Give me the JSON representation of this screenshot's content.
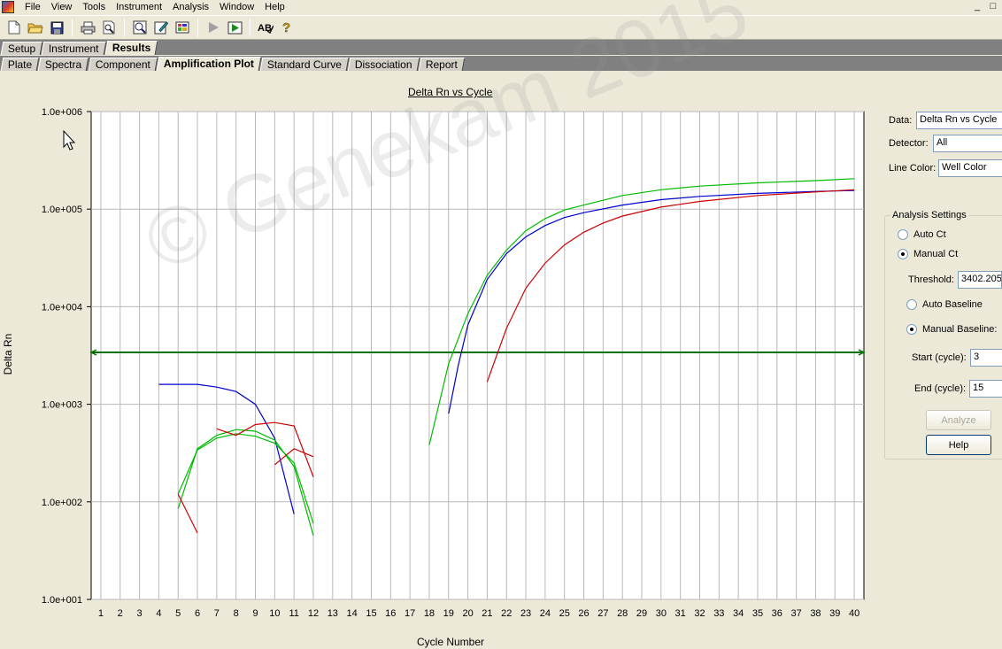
{
  "menu": [
    "File",
    "View",
    "Tools",
    "Instrument",
    "Analysis",
    "Window",
    "Help"
  ],
  "window_controls": [
    "_",
    "□"
  ],
  "toolbar_icons": [
    "new-file-icon",
    "open-folder-icon",
    "save-icon",
    "print-icon",
    "print-preview-icon",
    "zoom-icon",
    "edit-icon",
    "plate-grid-icon",
    "run-icon",
    "run-detector-icon",
    "spellcheck-icon",
    "help-icon"
  ],
  "tabs_top": [
    {
      "label": "Setup",
      "active": false
    },
    {
      "label": "Instrument",
      "active": false
    },
    {
      "label": "Results",
      "active": true
    }
  ],
  "tabs_sub": [
    {
      "label": "Plate",
      "active": false
    },
    {
      "label": "Spectra",
      "active": false
    },
    {
      "label": "Component",
      "active": false
    },
    {
      "label": "Amplification Plot",
      "active": true
    },
    {
      "label": "Standard Curve",
      "active": false
    },
    {
      "label": "Dissociation",
      "active": false
    },
    {
      "label": "Report",
      "active": false
    }
  ],
  "watermark": "© Genekam 2015",
  "chart_data": {
    "type": "line",
    "title": "Delta Rn vs Cycle",
    "xlabel": "Cycle Number",
    "ylabel": "Delta Rn",
    "yscale": "log",
    "xlim": [
      0.5,
      40.5
    ],
    "ylim": [
      10,
      1000000
    ],
    "x_ticks": [
      1,
      2,
      3,
      4,
      5,
      6,
      7,
      8,
      9,
      10,
      11,
      12,
      13,
      14,
      15,
      16,
      17,
      18,
      19,
      20,
      21,
      22,
      23,
      24,
      25,
      26,
      27,
      28,
      29,
      30,
      31,
      32,
      33,
      34,
      35,
      36,
      37,
      38,
      39,
      40
    ],
    "y_ticks": [
      10,
      100,
      1000,
      10000,
      100000,
      1000000
    ],
    "y_tick_labels": [
      "1.0e+001",
      "1.0e+002",
      "1.0e+003",
      "1.0e+004",
      "1.0e+005",
      "1.0e+006"
    ],
    "grid": true,
    "threshold": 3402.205,
    "threshold_color": "#007000",
    "series": [
      {
        "color": "#0000cc",
        "x": [
          4,
          5,
          6,
          7,
          8,
          9,
          10,
          11
        ],
        "y": [
          1600,
          1600,
          1600,
          1500,
          1350,
          1000,
          450,
          75
        ]
      },
      {
        "color": "#0000cc",
        "x": [
          19,
          19.5,
          20,
          21,
          22,
          23,
          24,
          25,
          26,
          28,
          30,
          32,
          35,
          38,
          40
        ],
        "y": [
          800,
          2500,
          6500,
          19000,
          35000,
          52000,
          68000,
          82000,
          92000,
          110000,
          125000,
          135000,
          145000,
          152000,
          155000
        ]
      },
      {
        "color": "#00bb00",
        "x": [
          5,
          6,
          7,
          8,
          9,
          10,
          11,
          12
        ],
        "y": [
          85,
          350,
          480,
          550,
          530,
          430,
          230,
          45
        ]
      },
      {
        "color": "#00bb00",
        "x": [
          5,
          6,
          7,
          8,
          9,
          10,
          11,
          12
        ],
        "y": [
          120,
          340,
          450,
          500,
          470,
          400,
          250,
          60
        ]
      },
      {
        "color": "#00bb00",
        "x": [
          18,
          19,
          20,
          21,
          22,
          23,
          24,
          25,
          26,
          28,
          30,
          32,
          35,
          38,
          40
        ],
        "y": [
          380,
          2600,
          8500,
          21000,
          38000,
          60000,
          80000,
          98000,
          110000,
          138000,
          158000,
          172000,
          186000,
          196000,
          205000
        ]
      },
      {
        "color": "#cc0000",
        "x": [
          5,
          6
        ],
        "y": [
          120,
          48
        ]
      },
      {
        "color": "#cc0000",
        "x": [
          7,
          8,
          9,
          10,
          11,
          12
        ],
        "y": [
          560,
          480,
          620,
          650,
          600,
          180
        ]
      },
      {
        "color": "#cc0000",
        "x": [
          10,
          11,
          12
        ],
        "y": [
          240,
          350,
          290
        ]
      },
      {
        "color": "#cc0000",
        "x": [
          21,
          22,
          23,
          24,
          25,
          26,
          27,
          28,
          30,
          32,
          35,
          38,
          40
        ],
        "y": [
          1700,
          6000,
          15500,
          28000,
          43000,
          58000,
          72000,
          85000,
          105000,
          120000,
          138000,
          150000,
          158000
        ]
      }
    ]
  },
  "panel": {
    "data_label": "Data:",
    "data_value": "Delta Rn vs Cycle",
    "detector_label": "Detector:",
    "detector_value": "All",
    "line_color_label": "Line Color:",
    "line_color_value": "Well Color",
    "analysis_settings_title": "Analysis Settings",
    "auto_ct": "Auto Ct",
    "manual_ct": "Manual Ct",
    "threshold_label": "Threshold:",
    "threshold_value": "3402.205",
    "auto_baseline": "Auto Baseline",
    "manual_baseline": "Manual Baseline:",
    "start_label": "Start (cycle):",
    "start_value": "3",
    "end_label": "End (cycle):",
    "end_value": "15",
    "analyze_button": "Analyze",
    "help_button": "Help",
    "ct_mode": "manual",
    "baseline_mode": "manual"
  }
}
